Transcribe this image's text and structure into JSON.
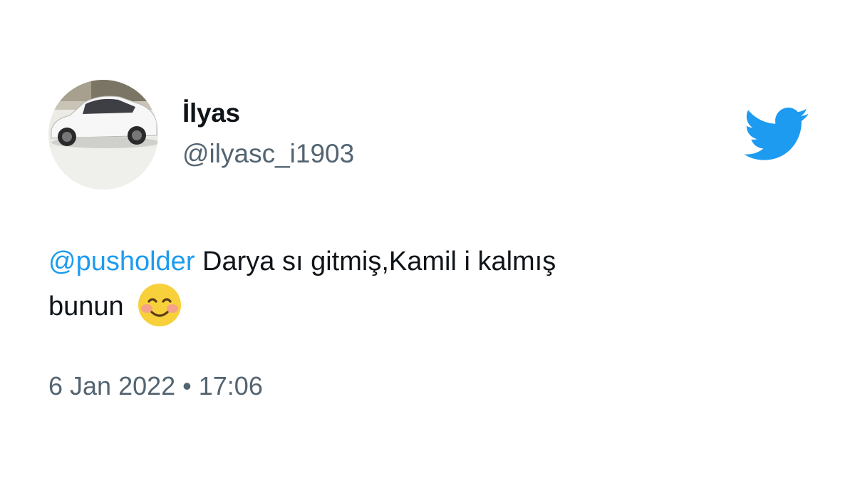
{
  "user": {
    "display_name": "İlyas",
    "handle": "@ilyasc_i1903",
    "avatar_icon": "car-avatar-icon"
  },
  "logo": {
    "icon": "twitter-bird-icon",
    "color": "#1d9bf0"
  },
  "tweet": {
    "mention": "@pusholder",
    "text_line1": "Darya sı gitmiş,Kamil i kalmış",
    "text_line2": "bunun",
    "emoji": "smiling-face-with-smiling-eyes"
  },
  "meta": {
    "date": "6 Jan 2022",
    "separator": "•",
    "time": "17:06"
  },
  "colors": {
    "text": "#0f1419",
    "secondary": "#536471",
    "link": "#1d9bf0",
    "background": "#ffffff"
  }
}
